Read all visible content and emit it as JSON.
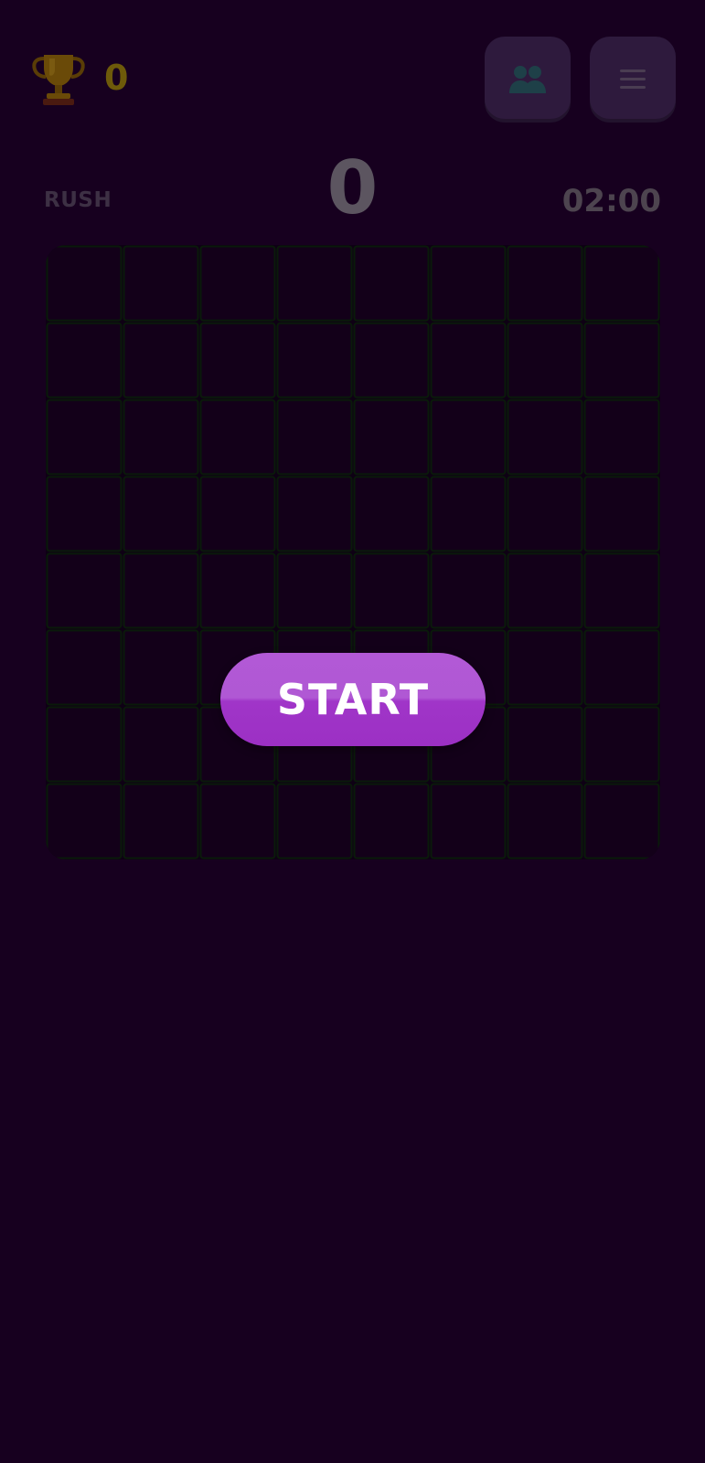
{
  "header": {
    "best_score": "0",
    "players_icon": "players-icon",
    "menu_icon": "menu-icon",
    "trophy_icon": "trophy-icon"
  },
  "status": {
    "mode": "RUSH",
    "score": "0",
    "timer": "02:00"
  },
  "board": {
    "rows": 8,
    "cols": 8
  },
  "actions": {
    "start_label": "START"
  },
  "colors": {
    "background": "#17001f",
    "board": "#0e0014",
    "grid_line": "#0a1a0a",
    "start_button": "#a83fcd",
    "trophy": "#6e5a0a"
  }
}
